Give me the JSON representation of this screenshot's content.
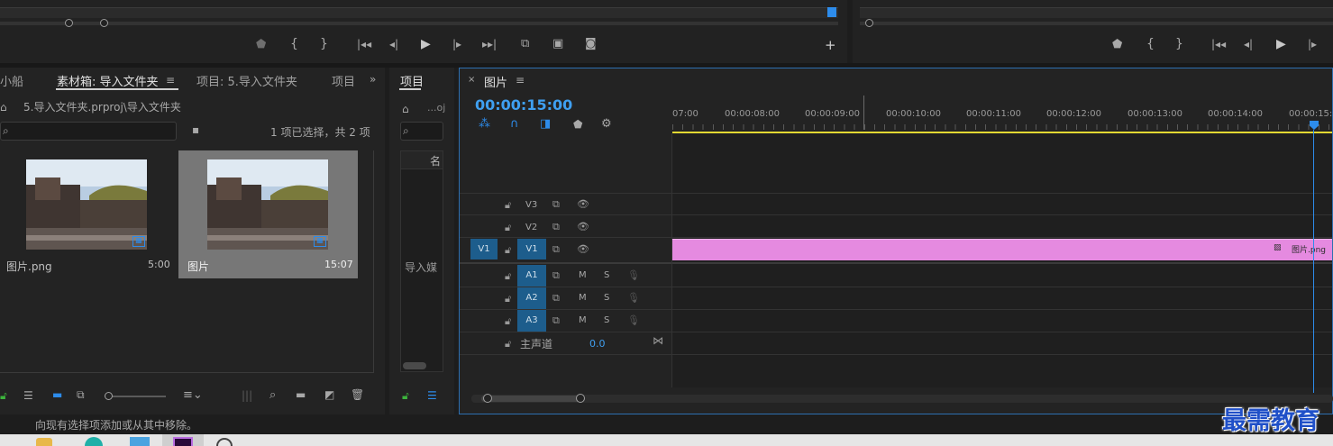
{
  "source_monitor": {
    "controls": [
      "marker-icon",
      "mark-in-icon",
      "mark-out-icon",
      "go-to-in-icon",
      "step-back-icon",
      "play-icon",
      "step-forward-icon",
      "go-to-out-icon",
      "insert-icon",
      "overwrite-icon",
      "export-frame-icon",
      "add-icon"
    ]
  },
  "program_monitor": {
    "controls": [
      "marker-icon",
      "mark-in-icon",
      "mark-out-icon",
      "go-to-in-icon",
      "step-back-icon",
      "play-icon",
      "step-forward-icon"
    ]
  },
  "bin_panel": {
    "tabs": [
      "小船",
      "素材箱: 导入文件夹",
      "项目: 5.导入文件夹",
      "项目"
    ],
    "path": "5.导入文件夹.prproj\\导入文件夹",
    "selection_status": "1 项已选择，共 2 项",
    "items": [
      {
        "name": "图片.png",
        "duration": "5:00",
        "selected": false
      },
      {
        "name": "图片",
        "duration": "15:07",
        "selected": true
      }
    ]
  },
  "project_panel": {
    "tab": "项目",
    "file_hint": "...oj",
    "column_header": "名",
    "placeholder": "导入媒"
  },
  "timeline": {
    "sequence_name": "图片",
    "timecode": "00:00:15:00",
    "ruler_labels": [
      "07:00",
      "00:00:08:00",
      "00:00:09:00",
      "00:00:10:00",
      "00:00:11:00",
      "00:00:12:00",
      "00:00:13:00",
      "00:00:14:00",
      "00:00:15:0"
    ],
    "video_tracks": [
      "V3",
      "V2",
      "V1"
    ],
    "source_patch": "V1",
    "audio_tracks": [
      {
        "name": "A1",
        "m": "M",
        "s": "S"
      },
      {
        "name": "A2",
        "m": "M",
        "s": "S"
      },
      {
        "name": "A3",
        "m": "M",
        "s": "S"
      }
    ],
    "master": {
      "label": "主声道",
      "value": "0.0"
    },
    "clip": {
      "label": "图片.png",
      "color": "#e58ae0"
    }
  },
  "status_bar": {
    "text": "向现有选择项添加或从其中移除。"
  },
  "watermark": "最需教育",
  "colors": {
    "accent_blue": "#2d8ceb",
    "timecode_blue": "#3f9ff0",
    "playhead_yellow": "#e2d832",
    "clip_pink": "#e58ae0"
  }
}
